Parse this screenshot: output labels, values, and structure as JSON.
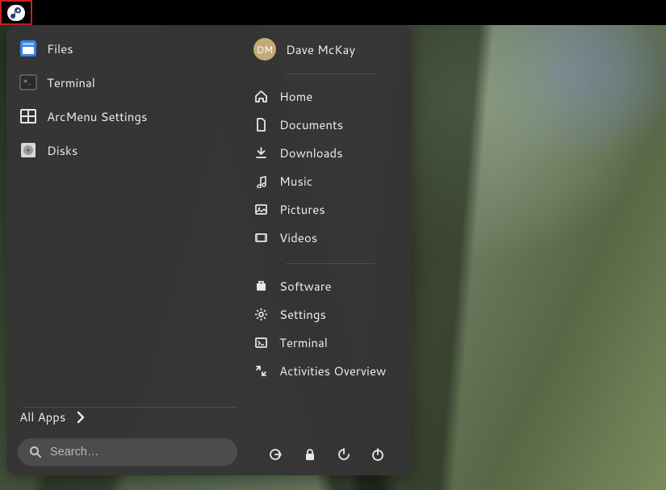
{
  "user": {
    "name": "Dave McKay",
    "initials": "DM"
  },
  "pinned": [
    {
      "label": "Files",
      "icon": "files"
    },
    {
      "label": "Terminal",
      "icon": "terminal"
    },
    {
      "label": "ArcMenu Settings",
      "icon": "arcmenu"
    },
    {
      "label": "Disks",
      "icon": "disks"
    }
  ],
  "places": [
    {
      "label": "Home",
      "icon": "home"
    },
    {
      "label": "Documents",
      "icon": "document"
    },
    {
      "label": "Downloads",
      "icon": "download"
    },
    {
      "label": "Music",
      "icon": "music"
    },
    {
      "label": "Pictures",
      "icon": "pictures"
    },
    {
      "label": "Videos",
      "icon": "videos"
    }
  ],
  "shortcuts": [
    {
      "label": "Software",
      "icon": "software"
    },
    {
      "label": "Settings",
      "icon": "settings"
    },
    {
      "label": "Terminal",
      "icon": "terminal2"
    },
    {
      "label": "Activities Overview",
      "icon": "activities"
    }
  ],
  "allAppsLabel": "All Apps",
  "searchPlaceholder": "Search…",
  "session": [
    "logout",
    "lock",
    "restart",
    "power"
  ]
}
